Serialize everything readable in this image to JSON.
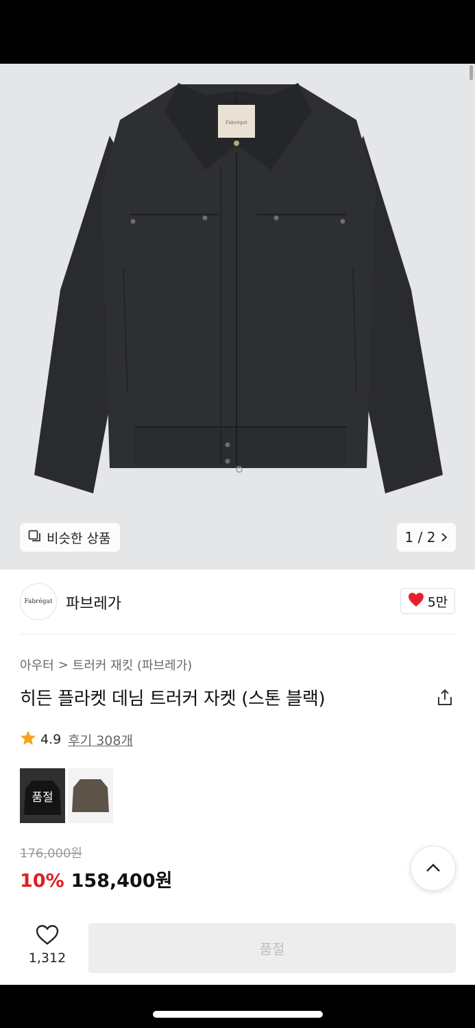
{
  "hero": {
    "garment_label_text": "Fabrégat",
    "similar_label": "비슷한 상품",
    "page_indicator": "1 / 2",
    "image_count_current": 1,
    "image_count_total": 2
  },
  "brand": {
    "logo_text": "Fabrégat",
    "name": "파브레가",
    "likes": "5만"
  },
  "breadcrumb": {
    "category": "아우터",
    "separator": ">",
    "subcategory": "트러커 재킷 (파브레가)"
  },
  "product": {
    "title": "히든 플라켓 데님 트러커 자켓 (스톤 블랙)",
    "rating": "4.9",
    "reviews": "후기 308개",
    "variant_soldout_label": "품절",
    "original_price": "176,000원",
    "discount": "10%",
    "price": "158,400원"
  },
  "bottom_bar": {
    "like_count": "1,312",
    "buy_label": "품절"
  },
  "colors": {
    "heart_red": "#e8202e",
    "discount_red": "#e02020",
    "star_orange": "#f5a31a",
    "jacket": "#2c2d2f"
  },
  "icons": [
    "similar-items-icon",
    "chevron-right-icon",
    "heart-filled-icon",
    "share-icon",
    "star-icon",
    "chevron-up-icon",
    "heart-outline-icon"
  ]
}
